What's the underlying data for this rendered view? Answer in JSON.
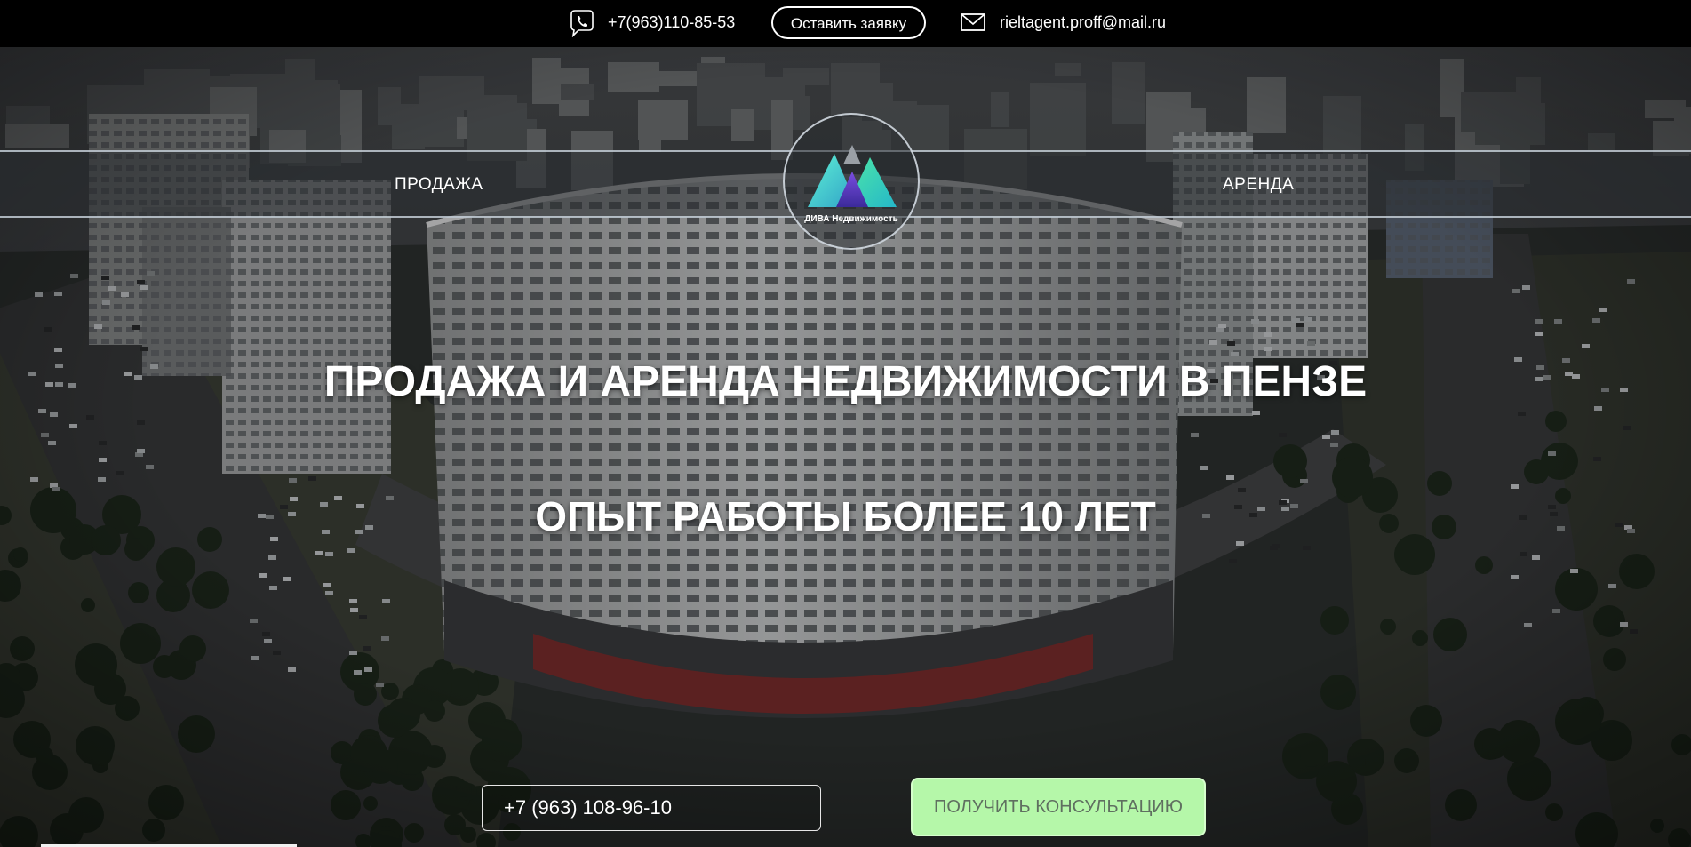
{
  "topbar": {
    "phone": "+7(963)110-85-53",
    "request_button": "Оставить заявку",
    "email": "rieltagent.proff@mail.ru",
    "phone_icon": "phone-icon",
    "mail_icon": "mail-icon"
  },
  "nav": {
    "sale": "ПРОДАЖА",
    "rent": "АРЕНДА"
  },
  "logo": {
    "text": "ДИВА Недвижимость"
  },
  "hero": {
    "headline": "ПРОДАЖА И АРЕНДА НЕДВИЖИМОСТИ В ПЕНЗЕ",
    "subheadline": "ОПЫТ РАБОТЫ БОЛЕЕ 10 ЛЕТ"
  },
  "cta": {
    "phone_placeholder": "+7 (963) 108-96-10",
    "button": "ПОЛУЧИТЬ КОНСУЛЬТАЦИЮ"
  },
  "colors": {
    "accent_green": "#b5f7a9",
    "topbar": "#000000"
  }
}
